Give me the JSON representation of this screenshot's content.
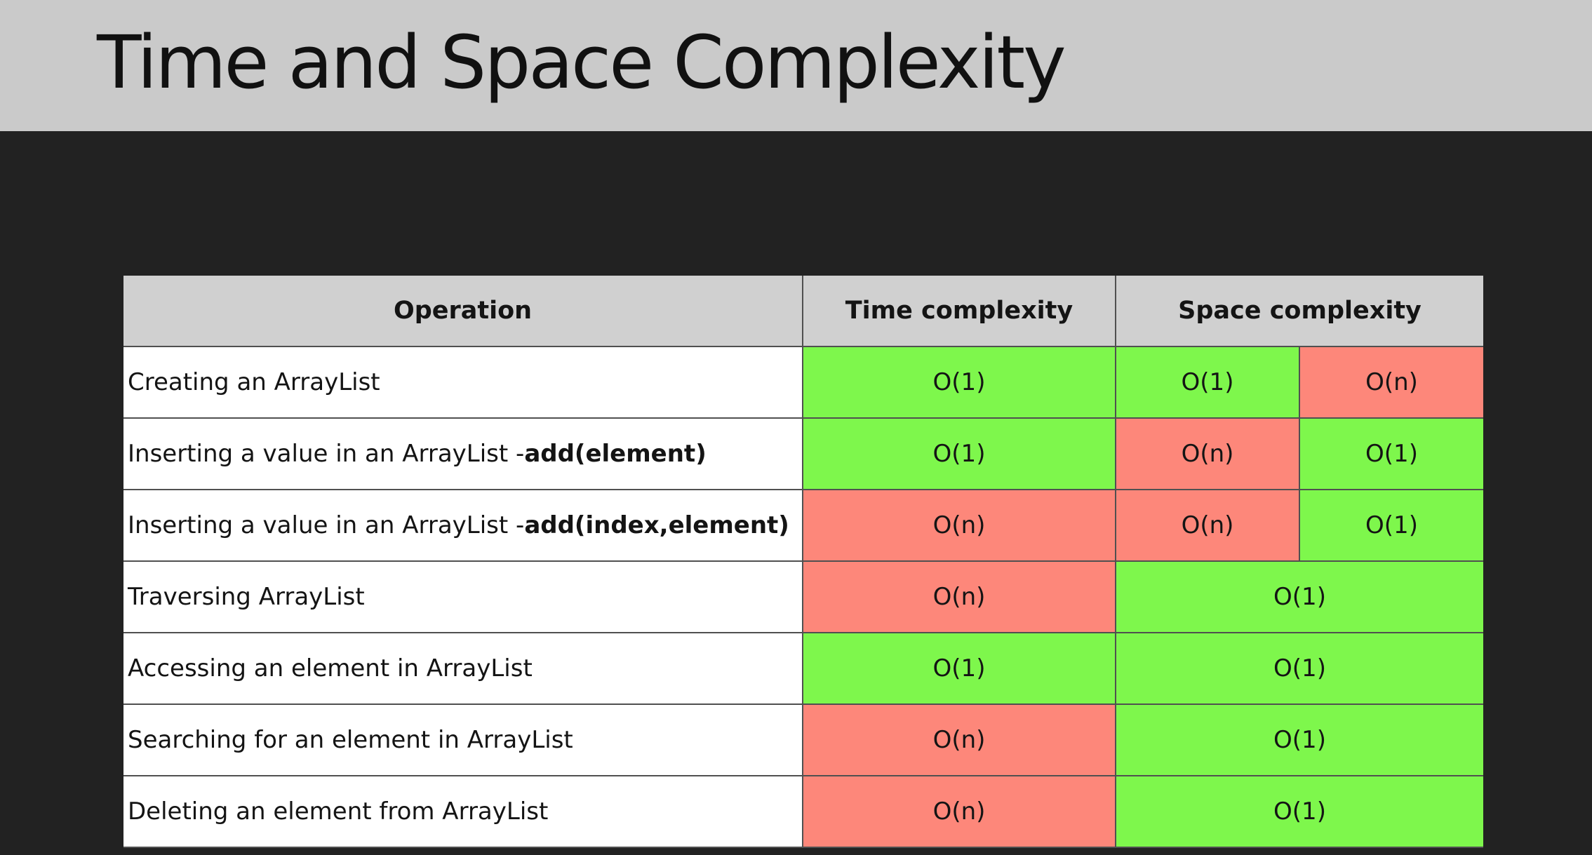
{
  "title": "Time and Space Complexity",
  "colors": {
    "good": "#7ef74c",
    "bad": "#fd877a",
    "header": "#d0d0d0",
    "background": "#222222",
    "title_bar": "#cacaca"
  },
  "table": {
    "headers": {
      "operation": "Operation",
      "time": "Time complexity",
      "space": "Space complexity"
    },
    "rows": [
      {
        "op": "Creating an ArrayList",
        "op_bold": "",
        "time": "O(1)",
        "space": [
          "O(1)",
          "O(n)"
        ]
      },
      {
        "op": "Inserting a value in an ArrayList - ",
        "op_bold": "add(element)",
        "time": "O(1)",
        "space": [
          "O(n)",
          "O(1)"
        ]
      },
      {
        "op": "Inserting a value in an ArrayList - ",
        "op_bold": "add(index,element)",
        "time": "O(n)",
        "space": [
          "O(n)",
          "O(1)"
        ]
      },
      {
        "op": "Traversing ArrayList",
        "op_bold": "",
        "time": "O(n)",
        "space": [
          "O(1)"
        ]
      },
      {
        "op": "Accessing an element in ArrayList",
        "op_bold": "",
        "time": "O(1)",
        "space": [
          "O(1)"
        ]
      },
      {
        "op": "Searching for an element in ArrayList",
        "op_bold": "",
        "time": "O(n)",
        "space": [
          "O(1)"
        ]
      },
      {
        "op": "Deleting an element from ArrayList",
        "op_bold": "",
        "time": "O(n)",
        "space": [
          "O(1)"
        ]
      }
    ]
  }
}
